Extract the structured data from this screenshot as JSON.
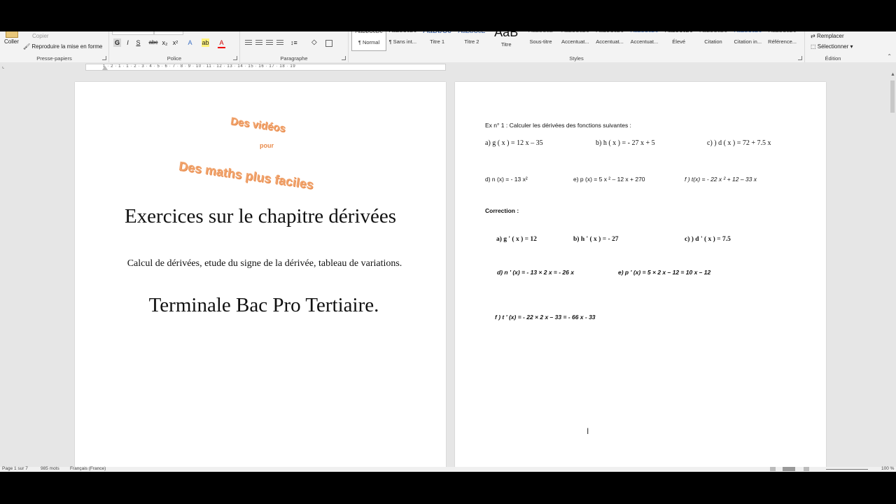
{
  "ribbon": {
    "clipboard": {
      "coller": "Coller",
      "copier": "Copier",
      "reproduire": "Reproduire la mise en forme",
      "label": "Presse-papiers"
    },
    "font": {
      "label": "Police",
      "buttons": [
        "G",
        "I",
        "S",
        "abc",
        "x₂",
        "x²"
      ]
    },
    "paragraph": {
      "label": "Paragraphe"
    },
    "styles": {
      "label": "Styles",
      "items": [
        {
          "preview": "AaBbCcDc",
          "name": "¶ Normal"
        },
        {
          "preview": "AaBbCcDc",
          "name": "¶ Sans int..."
        },
        {
          "preview": "AaBbCc",
          "name": "Titre 1"
        },
        {
          "preview": "AaBbCcE",
          "name": "Titre 2"
        },
        {
          "preview": "AaB",
          "name": "Titre"
        },
        {
          "preview": "AaBbCcE",
          "name": "Sous-titre"
        },
        {
          "preview": "AaBbCcDc",
          "name": "Accentuat..."
        },
        {
          "preview": "AaBbCcDc",
          "name": "Accentuat..."
        },
        {
          "preview": "AaBbCcDc",
          "name": "Accentuat..."
        },
        {
          "preview": "AaBbCcDc",
          "name": "Élevé"
        },
        {
          "preview": "AaBbCcDc",
          "name": "Citation"
        },
        {
          "preview": "AaBbCcDc",
          "name": "Citation in..."
        },
        {
          "preview": "AaBbCcDc",
          "name": "Référence..."
        }
      ]
    },
    "edition": {
      "remplacer": "Remplacer",
      "selectionner": "Sélectionner",
      "label": "Édition"
    }
  },
  "ruler": {
    "marks": "1 · 2 · 1 · 1 · 2 · 3 · 4 · 5 · 6 · 7 · 8 · 9 · 10 · 11 · 12 · 13 · 14 · 15 · 16 · 17 · 18 · 19"
  },
  "page1": {
    "wordart_top": "Des vidéos",
    "wordart_mid": "pour",
    "wordart_bottom": "Des maths plus faciles",
    "title": "Exercices sur le chapitre dérivées",
    "subtitle": "Calcul de dérivées, etude du signe de la dérivée, tableau de variations.",
    "level": "Terminale Bac Pro Tertiaire."
  },
  "page2": {
    "exercise_title": "Ex n° 1 : Calculer les dérivées des fonctions suivantes :",
    "a": "a)    g ( x ) = 12 x – 35",
    "b": "b) h ( x ) = - 27 x + 5",
    "c": "c) ) d ( x ) = 72 + 7.5 x",
    "d": "d) n (x) = - 13 x²",
    "e": "e) p (x) = 5 x ² – 12 x + 270",
    "f": "f )  t(x) = - 22 x ²  + 12 – 33 x",
    "correction_label": "Correction :",
    "ca": "a)   g ' ( x ) = 12",
    "cb": "b)      h ' ( x ) = - 27",
    "cc": "c) )     d ' ( x ) = 7.5",
    "cd": "d)   n ' (x) = - 13 × 2 x = - 26 x",
    "ce": "e) p ' (x) = 5 × 2 x  – 12 = 10 x – 12",
    "cf": "f )   t ' (x) = - 22 × 2 x  – 33 = - 66 x - 33"
  },
  "status": {
    "page": "Page 1 sur 7",
    "words": "985 mots",
    "language": "Français (France)",
    "zoom": "100 %"
  }
}
